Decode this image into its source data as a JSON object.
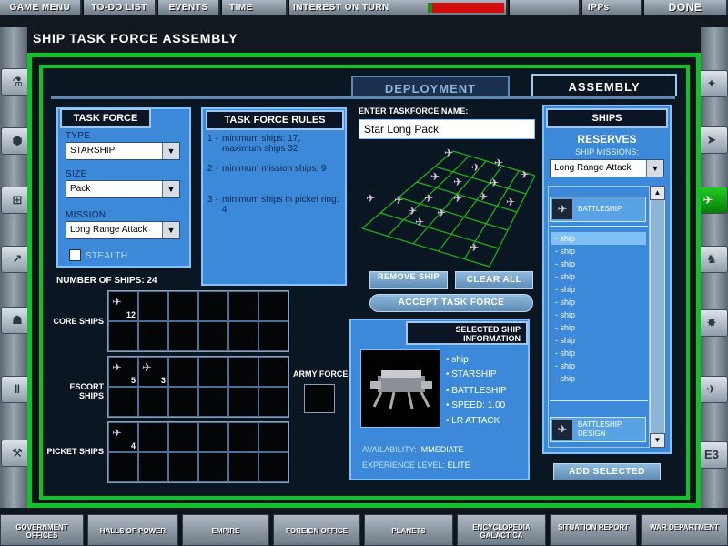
{
  "topbar": {
    "game_menu": "GAME MENU",
    "todo": "TO-DO LIST",
    "events": "EVENTS",
    "time": "TIME",
    "interest": "INTEREST ON TURN",
    "ipps": "IPPs",
    "done": "DONE"
  },
  "page_title": "SHIP TASK FORCE ASSEMBLY",
  "tabs": {
    "deployment": "DEPLOYMENT",
    "assembly": "ASSEMBLY"
  },
  "taskforce": {
    "title": "TASK FORCE",
    "type_label": "TYPE",
    "type_value": "STARSHIP",
    "size_label": "SIZE",
    "size_value": "Pack",
    "mission_label": "MISSION",
    "mission_value": "Long Range Attack",
    "stealth": "STEALTH"
  },
  "rules": {
    "title": "TASK FORCE RULES",
    "items": [
      {
        "n": "1 -",
        "t": "minimum ships: 17, maximum ships 32"
      },
      {
        "n": "2 -",
        "t": "minimum mission ships: 9"
      },
      {
        "n": "3 -",
        "t": "minimum ships in picket ring: 4"
      }
    ]
  },
  "name": {
    "label": "ENTER TASKFORCE NAME:",
    "value": "Star Long Pack"
  },
  "buttons": {
    "remove_ship": "REMOVE SHIP",
    "clear_all": "CLEAR ALL",
    "accept": "ACCEPT TASK FORCE",
    "add_selected": "ADD SELECTED"
  },
  "num_ships": {
    "label": "NUMBER OF SHIPS:",
    "value": "24"
  },
  "groups": {
    "core": "CORE SHIPS",
    "escort": "ESCORT SHIPS",
    "picket": "PICKET SHIPS",
    "army": "ARMY FORCES",
    "core_count": "12",
    "escort_count1": "5",
    "escort_count2": "3",
    "picket_count": "4"
  },
  "selected": {
    "title": "SELECTED SHIP INFORMATION",
    "line1": "ship",
    "line2": "STARSHIP",
    "line3": "BATTLESHIP",
    "line4": "SPEED: 1.00",
    "line5": "LR ATTACK",
    "avail_label": "AVAILABILITY:",
    "avail_value": "IMMEDIATE",
    "exp_label": "EXPERIENCE LEVEL:",
    "exp_value": "ELITE"
  },
  "ships": {
    "title": "SHIPS",
    "reserves": "RESERVES",
    "missions_label": "SHIP MISSIONS:",
    "mission_value": "Long Range Attack",
    "header_item": "BATTLESHIP",
    "items": [
      "- ship",
      "- ship",
      "- ship",
      "- ship",
      "- ship",
      "- ship",
      "- ship",
      "- ship",
      "- ship",
      "- ship",
      "- ship",
      "- ship"
    ],
    "design_item": "BATTLESHIP DESIGN"
  },
  "bottom": {
    "gov": "GOVERNMENT OFFICES",
    "halls": "HALLS OF POWER",
    "empire": "EMPIRE",
    "foreign": "FOREIGN OFFICE",
    "planets": "PLANETS",
    "encyclo": "ENCYCLOPEDIA GALACTICA",
    "situation": "SITUATION REPORT",
    "war": "WAR DEPARTMENT"
  },
  "side": {
    "e3": "E3"
  },
  "colors": {
    "accent_green": "#0ec32a",
    "panel_blue": "#3d89d9",
    "interest_red": "#d40c0c"
  }
}
